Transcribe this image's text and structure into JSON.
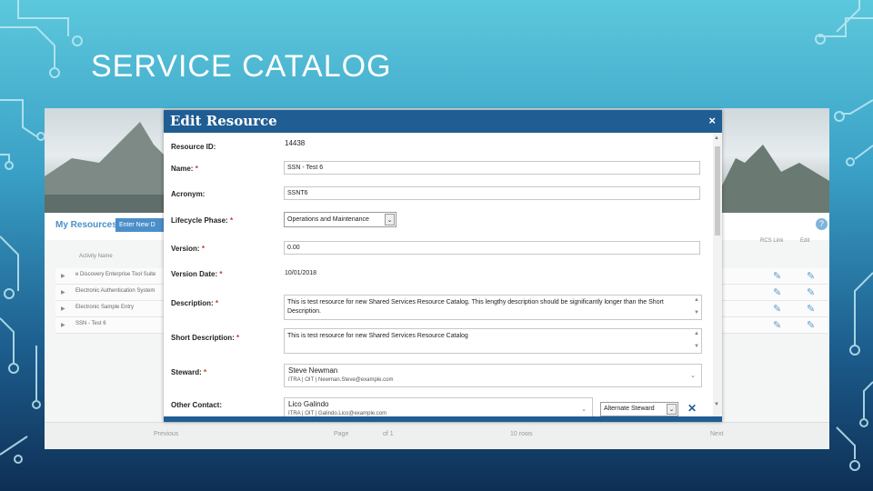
{
  "slide": {
    "title": "SERVICE CATALOG"
  },
  "app": {
    "my_resources_label": "My Resources",
    "enter_new_button": "Enter New D",
    "help_icon": "?",
    "columns": {
      "name": "Activity Name",
      "rcs_link": "RCS Link",
      "edit": "Edit"
    },
    "rows": [
      {
        "name": "e Discovery Enterprise Tool Suite"
      },
      {
        "name": "Electronic Authentication System"
      },
      {
        "name": "Electronic Sample Entry"
      },
      {
        "name": "SSN - Test 6"
      }
    ],
    "pager": {
      "previous": "Previous",
      "page": "Page",
      "of": "of 1",
      "rows": "10 rows",
      "next": "Next"
    }
  },
  "modal": {
    "title": "Edit Resource",
    "close": "×",
    "fields": {
      "resource_id": {
        "label": "Resource ID:",
        "value": "14438"
      },
      "name": {
        "label": "Name:",
        "value": "SSN - Test 6"
      },
      "acronym": {
        "label": "Acronym:",
        "value": "SSNT6"
      },
      "lifecycle_phase": {
        "label": "Lifecycle Phase:",
        "value": "Operations and Maintenance"
      },
      "version": {
        "label": "Version:",
        "value": "0.00"
      },
      "version_date": {
        "label": "Version Date:",
        "value": "10/01/2018"
      },
      "description": {
        "label": "Description:",
        "value": "This is test resource for new Shared Services Resource Catalog. This lengthy description should be significantly longer than the Short Description."
      },
      "short_description": {
        "label": "Short Description:",
        "value": "This is test resource for new Shared Services Resource Catalog"
      },
      "steward": {
        "label": "Steward:",
        "name": "Steve Newman",
        "detail": "ITRA | OIT | Newman.Steve@example.com"
      },
      "other_contact": {
        "label": "Other Contact:",
        "name": "Lico Galindo",
        "detail": "ITRA | OIT | Galindo.Lico@example.com",
        "role": "Alternate Steward"
      }
    },
    "required_mark": "*"
  },
  "colors": {
    "modal_header": "#1f5d93",
    "link_blue": "#4b8fc9",
    "required": "#c0392b"
  }
}
